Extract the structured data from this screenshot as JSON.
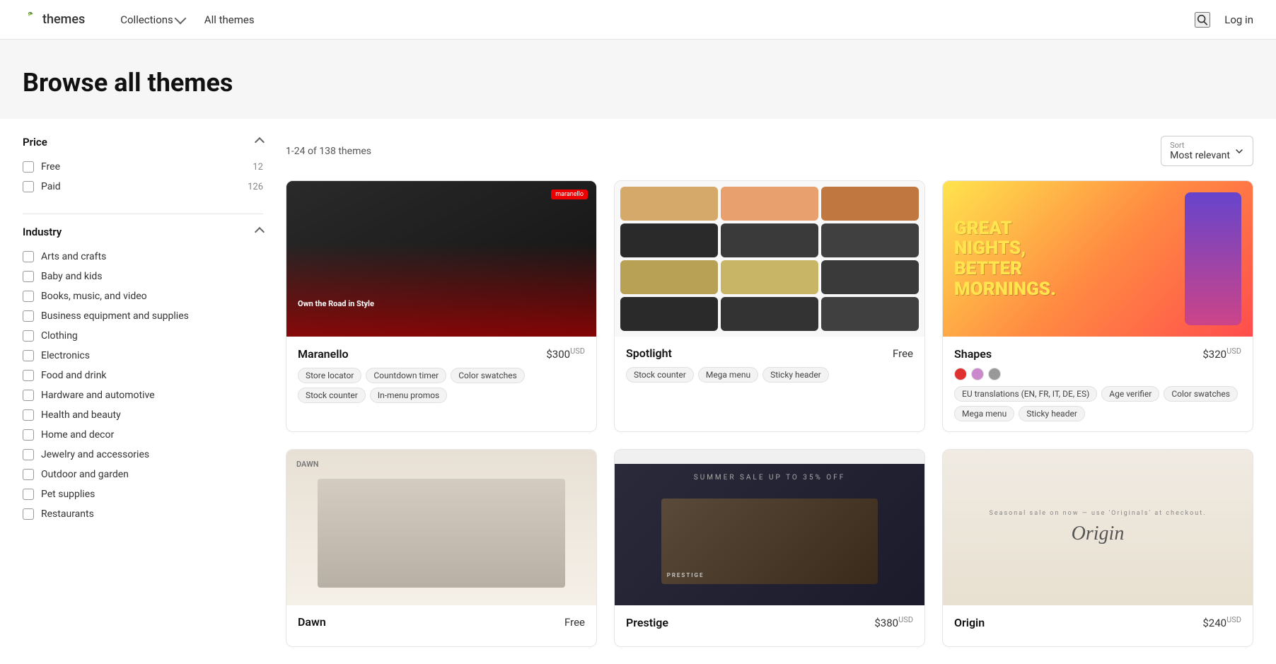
{
  "header": {
    "logo_text": "themes",
    "nav_items": [
      {
        "label": "Collections",
        "has_dropdown": true
      },
      {
        "label": "All themes",
        "has_dropdown": false
      }
    ],
    "login_label": "Log in"
  },
  "hero": {
    "title": "Browse all themes"
  },
  "sidebar": {
    "price_section": {
      "label": "Price",
      "items": [
        {
          "label": "Free",
          "count": "12"
        },
        {
          "label": "Paid",
          "count": "126"
        }
      ]
    },
    "industry_section": {
      "label": "Industry",
      "items": [
        {
          "label": "Arts and crafts"
        },
        {
          "label": "Baby and kids"
        },
        {
          "label": "Books, music, and video"
        },
        {
          "label": "Business equipment and supplies"
        },
        {
          "label": "Clothing"
        },
        {
          "label": "Electronics"
        },
        {
          "label": "Food and drink"
        },
        {
          "label": "Hardware and automotive"
        },
        {
          "label": "Health and beauty"
        },
        {
          "label": "Home and decor"
        },
        {
          "label": "Jewelry and accessories"
        },
        {
          "label": "Outdoor and garden"
        },
        {
          "label": "Pet supplies"
        },
        {
          "label": "Restaurants"
        }
      ]
    }
  },
  "content": {
    "count_text": "1-24 of 138 themes",
    "sort": {
      "label": "Sort",
      "value": "Most relevant"
    },
    "themes": [
      {
        "name": "Maranello",
        "price": "$300",
        "currency": "USD",
        "tags": [
          "Store locator",
          "Countdown timer",
          "Color swatches",
          "Stock counter",
          "In-menu promos"
        ],
        "style": "maranello"
      },
      {
        "name": "Spotlight",
        "price": "Free",
        "currency": "",
        "tags": [
          "Stock counter",
          "Mega menu",
          "Sticky header"
        ],
        "style": "spotlight"
      },
      {
        "name": "Shapes",
        "price": "$320",
        "currency": "USD",
        "swatches": [
          "#e03030",
          "#cc88cc",
          "#999999"
        ],
        "tags": [
          "EU translations (EN, FR, IT, DE, ES)",
          "Age verifier",
          "Color swatches",
          "Mega menu",
          "Sticky header"
        ],
        "style": "shapes"
      },
      {
        "name": "Dawn",
        "price": "Free",
        "currency": "",
        "tags": [],
        "style": "dawn"
      },
      {
        "name": "Prestige",
        "price": "$380",
        "currency": "USD",
        "tags": [],
        "style": "prestige"
      },
      {
        "name": "Origin",
        "price": "$240",
        "currency": "USD",
        "tags": [],
        "style": "origin"
      }
    ]
  }
}
